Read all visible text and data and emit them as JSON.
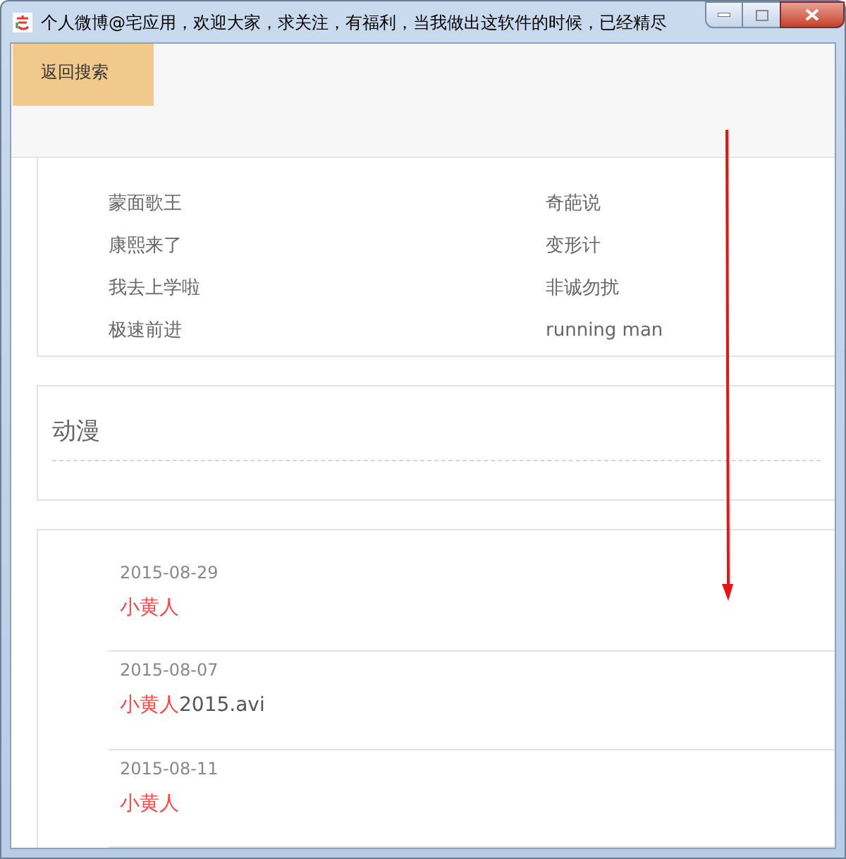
{
  "window": {
    "title": "个人微博@宅应用，欢迎大家，求关注，有福利，当我做出这软件的时候，已经精尽"
  },
  "back_button": {
    "label": "返回搜索"
  },
  "show_list": {
    "rows": [
      {
        "left": "蒙面歌王",
        "right": "奇葩说"
      },
      {
        "left": "康熙来了",
        "right": "变形计"
      },
      {
        "left": "我去上学啦",
        "right": "非诚勿扰"
      },
      {
        "left": "极速前进",
        "right": "running man"
      }
    ]
  },
  "anime_section": {
    "heading": "动漫"
  },
  "results": [
    {
      "date": "2015-08-29",
      "title_parts": [
        {
          "text": "小黄人",
          "highlight": true
        }
      ]
    },
    {
      "date": "2015-08-07",
      "title_parts": [
        {
          "text": "小黄人",
          "highlight": true
        },
        {
          "text": "2015.avi",
          "highlight": false
        }
      ]
    },
    {
      "date": "2015-08-11",
      "title_parts": [
        {
          "text": "小黄人",
          "highlight": true
        }
      ]
    }
  ]
}
